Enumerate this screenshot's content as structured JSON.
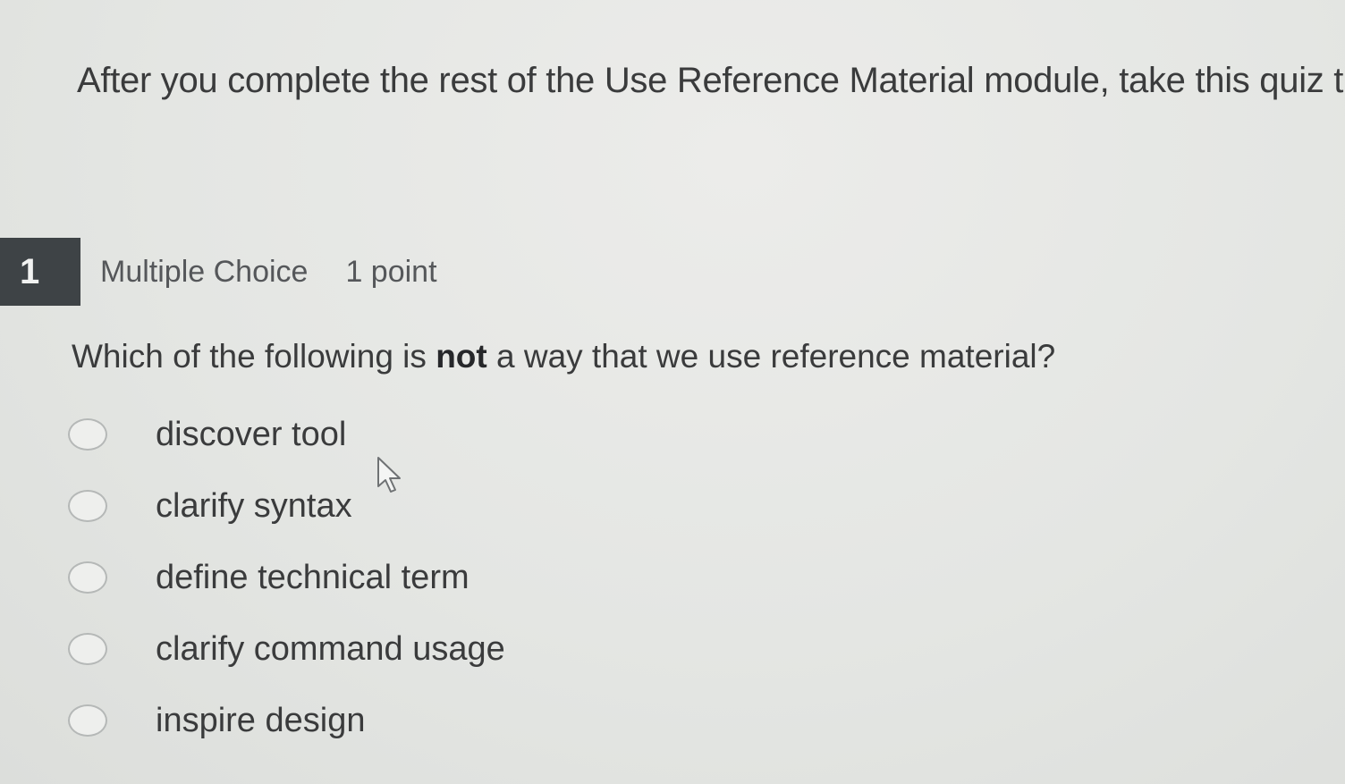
{
  "intro": {
    "text": "After you complete the rest of the Use Reference Material module, take this quiz t"
  },
  "question": {
    "number": "1",
    "type": "Multiple Choice",
    "points": "1 point",
    "text_before": "Which of the following is ",
    "text_emphasis": "not",
    "text_after": " a way that we use reference material?",
    "options": [
      {
        "label": "discover tool"
      },
      {
        "label": "clarify syntax"
      },
      {
        "label": "deﬁne technical term"
      },
      {
        "label": "clarify command usage"
      },
      {
        "label": "inspire design"
      }
    ]
  },
  "icons": {
    "cursor": "mouse-pointer-icon",
    "radio": "radio-button-empty"
  },
  "colors": {
    "number_badge_bg": "#3e4346",
    "number_badge_text": "#f1f2f1",
    "page_bg": "#e3e5e3",
    "text": "#3a3b3c"
  }
}
